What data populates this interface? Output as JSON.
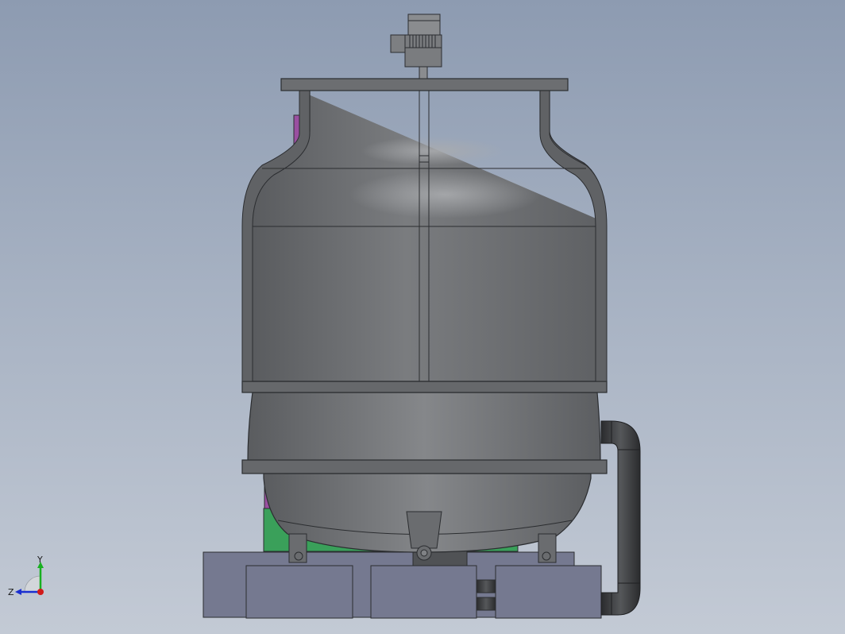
{
  "viewport": {
    "background_top": "#8d9bb1",
    "background_bottom": "#c3cad5"
  },
  "model": {
    "body_color": "#6e7073",
    "outline_color": "#2b2d30",
    "base_color": "#757990",
    "pipe_color": "#3a3b3e",
    "accent_purple": "#9a4fa0",
    "accent_green": "#3aa05a"
  },
  "triad": {
    "x_color": "#d11a1a",
    "y_color": "#18b020",
    "z_color": "#1b2fd0",
    "y_label": "Y",
    "z_label": "Z"
  }
}
